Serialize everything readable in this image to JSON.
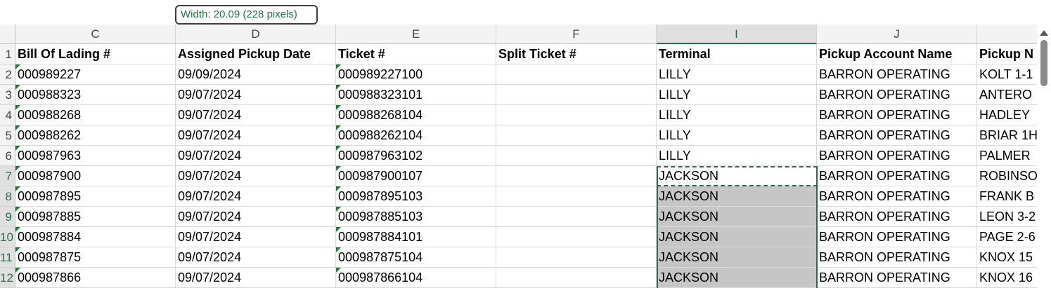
{
  "tooltip": "Width: 20.09 (228 pixels)",
  "columns": [
    "C",
    "D",
    "E",
    "F",
    "I",
    "J",
    ""
  ],
  "row_numbers": [
    "1",
    "2",
    "3",
    "4",
    "5",
    "6",
    "7",
    "8",
    "9",
    "10",
    "11",
    "12"
  ],
  "headers": [
    "Bill Of Lading #",
    "Assigned Pickup Date",
    "Ticket #",
    "Split Ticket #",
    "Terminal",
    "Pickup Account Name",
    "Pickup N"
  ],
  "rows": [
    [
      "000989227",
      "09/09/2024",
      "000989227100",
      "",
      "LILLY",
      "BARRON OPERATING",
      "KOLT 1-1"
    ],
    [
      "000988323",
      "09/07/2024",
      "000988323101",
      "",
      "LILLY",
      "BARRON OPERATING",
      "ANTERO"
    ],
    [
      "000988268",
      "09/07/2024",
      "000988268104",
      "",
      "LILLY",
      "BARRON OPERATING",
      "HADLEY"
    ],
    [
      "000988262",
      "09/07/2024",
      "000988262104",
      "",
      "LILLY",
      "BARRON OPERATING",
      "BRIAR 1H"
    ],
    [
      "000987963",
      "09/07/2024",
      "000987963102",
      "",
      "LILLY",
      "BARRON OPERATING",
      "PALMER"
    ],
    [
      "000987900",
      "09/07/2024",
      "000987900107",
      "",
      "JACKSON",
      "BARRON OPERATING",
      "ROBINSO"
    ],
    [
      "000987895",
      "09/07/2024",
      "000987895103",
      "",
      "JACKSON",
      "BARRON OPERATING",
      "FRANK B"
    ],
    [
      "000987885",
      "09/07/2024",
      "000987885103",
      "",
      "JACKSON",
      "BARRON OPERATING",
      "LEON 3-2"
    ],
    [
      "000987884",
      "09/07/2024",
      "000987884101",
      "",
      "JACKSON",
      "BARRON OPERATING",
      "PAGE 2-6"
    ],
    [
      "000987875",
      "09/07/2024",
      "000987875104",
      "",
      "JACKSON",
      "BARRON OPERATING",
      "KNOX 15"
    ],
    [
      "000987866",
      "09/07/2024",
      "000987866104",
      "",
      "JACKSON",
      "BARRON OPERATING",
      "KNOX 16"
    ]
  ],
  "selected_column": "I",
  "selected_rows": [
    "7",
    "8",
    "9",
    "10",
    "11",
    "12"
  ],
  "icons": {
    "scroll_up": "chevron-up-icon"
  },
  "colors": {
    "accent": "#217346",
    "selection_fill": "#c6c6c6"
  }
}
